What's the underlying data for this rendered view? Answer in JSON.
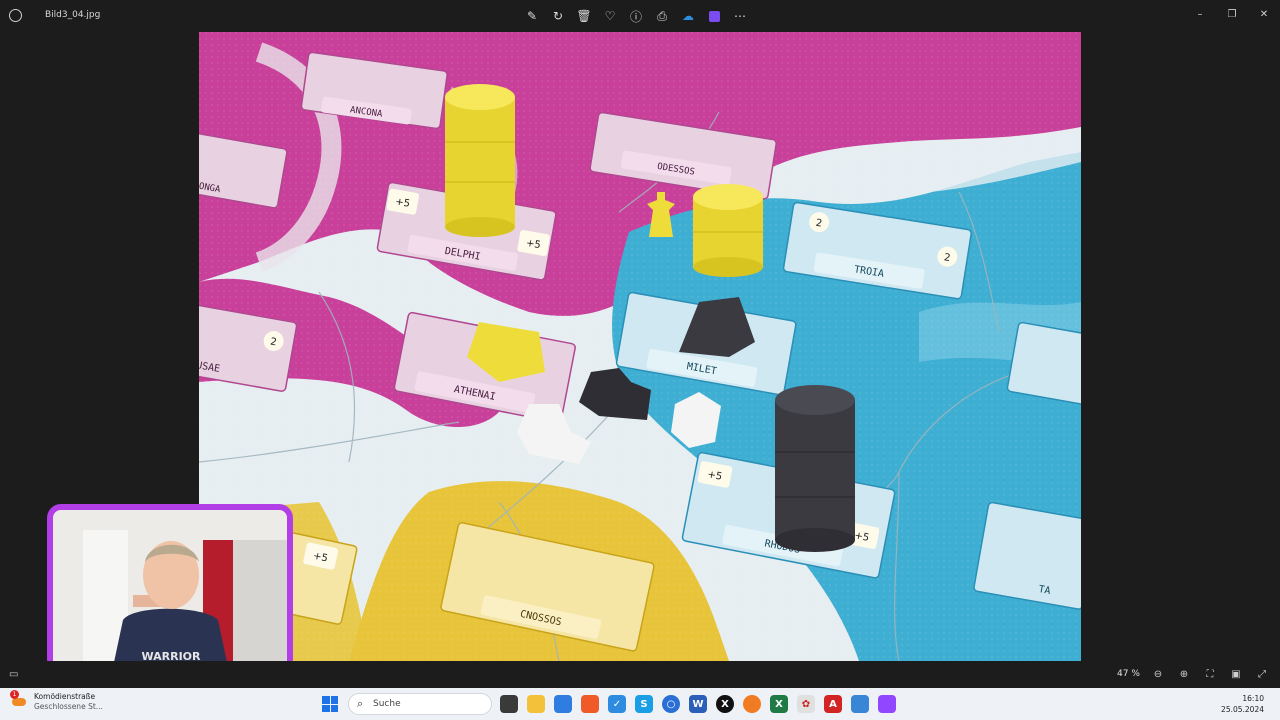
{
  "window": {
    "file_name": "Bild3_04.jpg"
  },
  "toolbar": {
    "icons": [
      "edit-icon",
      "rotate-icon",
      "delete-icon",
      "favorite-icon",
      "info-icon",
      "print-icon",
      "onedrive-icon",
      "clipchamp-icon",
      "more-icon"
    ]
  },
  "photo": {
    "city_labels": [
      "ANCONA",
      "ONGA",
      "ODESSOS",
      "DELPHI",
      "TROIA",
      "USAE",
      "ATHENAI",
      "MILET",
      "RHODOS",
      "CNOSSOS",
      "TA"
    ],
    "bonus_labels": [
      "+5",
      "+5",
      "+5",
      "+5",
      "+5"
    ],
    "victory_labels": [
      "2",
      "2",
      "2"
    ],
    "colors": {
      "sea": "#e6eef2",
      "pink_region": "#c8409a",
      "blue_region": "#3eaed2",
      "yellow_region": "#e7c43a",
      "yellow_piece": "#f2e04a",
      "black_piece": "#3a3a40",
      "white_piece": "#f4f4f4"
    }
  },
  "webcam": {
    "shirt_text": "WARRIOR",
    "frame_color": "#b23ee8"
  },
  "statusbar": {
    "zoom": "47 %"
  },
  "taskbar": {
    "weather_badge": "1",
    "weather_title": "Komödienstraße",
    "weather_sub": "Geschlossene St...",
    "search_placeholder": "Suche",
    "time": "16:10",
    "date": "25.05.2024"
  }
}
